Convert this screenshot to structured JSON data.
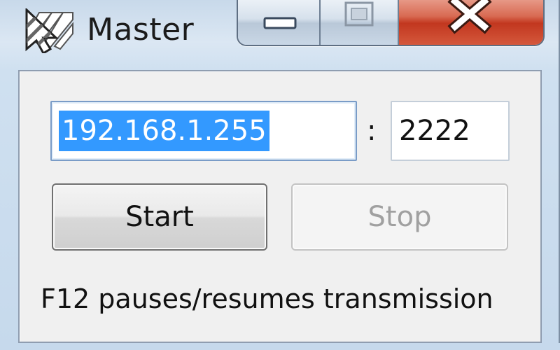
{
  "window": {
    "title": "Master",
    "icon": "striped-cursor-app-icon",
    "controls": {
      "minimize_icon": "minimize-icon",
      "maximize_icon": "maximize-icon",
      "close_icon": "close-icon"
    }
  },
  "form": {
    "address_value": "192.168.1.255",
    "separator": ":",
    "port_value": "2222",
    "start_label": "Start",
    "stop_label": "Stop",
    "stop_enabled": false,
    "hint": "F12 pauses/resumes transmission"
  },
  "colors": {
    "selection": "#3399ff",
    "close_button": "#c2371f",
    "disabled_text": "#a0a0a0"
  }
}
